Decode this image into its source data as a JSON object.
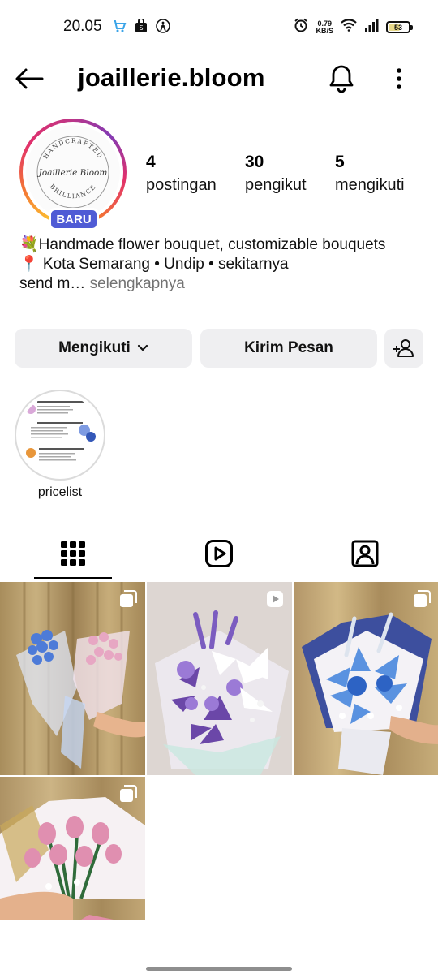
{
  "status_bar": {
    "time": "20.05",
    "net_speed_value": "0.79",
    "net_speed_unit": "KB/S",
    "battery_level": "53"
  },
  "header": {
    "username": "joaillerie.bloom",
    "icons": [
      "back-arrow-icon",
      "bell-icon",
      "more-vertical-icon"
    ]
  },
  "profile": {
    "avatar_text": {
      "top_arc": "HANDCRAFTED",
      "script": "Joaillerie Bloom",
      "bottom_arc": "BRILLIANCE"
    },
    "badge": "BARU",
    "stats": [
      {
        "value": "4",
        "label": "postingan"
      },
      {
        "value": "30",
        "label": "pengikut"
      },
      {
        "value": "5",
        "label": "mengikuti"
      }
    ],
    "bio": {
      "line1": "💐Handmade flower bouquet, customizable bouquets",
      "line2": "📍 Kota Semarang • Undip • sekitarnya",
      "line3": "send m…",
      "more": " selengkapnya"
    }
  },
  "actions": {
    "following": "Mengikuti",
    "message": "Kirim Pesan"
  },
  "highlights": [
    {
      "label": "pricelist"
    }
  ],
  "tabs": [
    "grid-icon",
    "reels-icon",
    "tagged-icon"
  ],
  "posts": [
    {
      "type": "carousel",
      "palette": [
        "#b59a6a",
        "#5e8ad6",
        "#e6a9c8"
      ]
    },
    {
      "type": "video",
      "palette": [
        "#ddd6d2",
        "#6b47a8",
        "#f2f2f2"
      ]
    },
    {
      "type": "carousel",
      "palette": [
        "#c0a06a",
        "#3d4f9e",
        "#5a92e0"
      ]
    },
    {
      "type": "carousel",
      "palette": [
        "#b89c6e",
        "#f1e8e8",
        "#e08fb0"
      ]
    }
  ]
}
